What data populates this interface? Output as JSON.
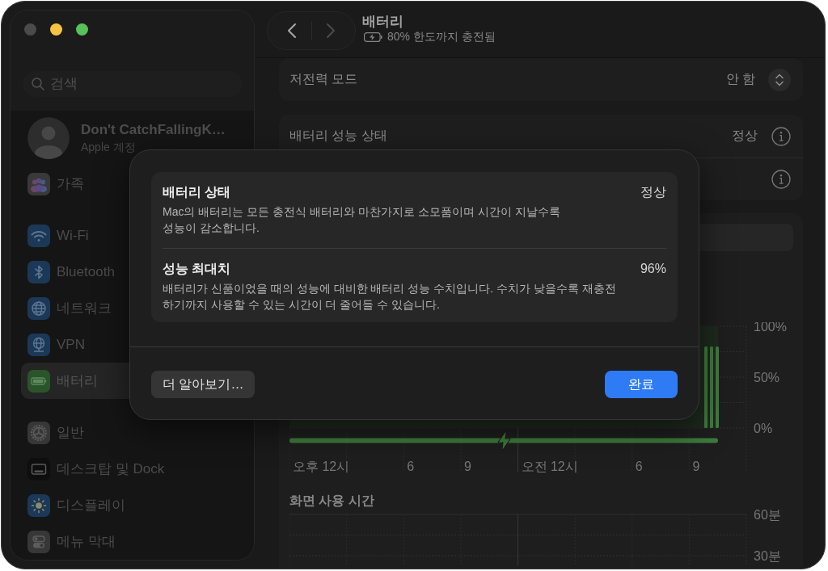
{
  "window": {
    "traffic_lights": [
      {
        "kind": "close",
        "disabled": true
      },
      {
        "kind": "minimize",
        "disabled": false
      },
      {
        "kind": "zoom",
        "disabled": false
      }
    ]
  },
  "sidebar": {
    "search": {
      "placeholder": "검색"
    },
    "account": {
      "name": "Don't CatchFallingK…",
      "subtitle": "Apple 계정"
    },
    "sections": [
      {
        "items": [
          {
            "label": "가족",
            "kind": "family",
            "selected": false
          }
        ]
      },
      {
        "items": [
          {
            "label": "Wi-Fi",
            "kind": "wifi",
            "selected": false
          },
          {
            "label": "Bluetooth",
            "kind": "bluetooth",
            "selected": false
          },
          {
            "label": "네트워크",
            "kind": "network",
            "selected": false
          },
          {
            "label": "VPN",
            "kind": "vpn",
            "selected": false
          },
          {
            "label": "배터리",
            "kind": "battery",
            "selected": true
          }
        ]
      },
      {
        "items": [
          {
            "label": "일반",
            "kind": "general",
            "selected": false
          },
          {
            "label": "데스크탑 및 Dock",
            "kind": "dock",
            "selected": false
          },
          {
            "label": "디스플레이",
            "kind": "display",
            "selected": false
          },
          {
            "label": "메뉴 막대",
            "kind": "menubar",
            "selected": false
          }
        ]
      }
    ]
  },
  "toolbar": {
    "nav_buttons": [
      {
        "kind": "back",
        "disabled": false
      },
      {
        "kind": "forward",
        "disabled": true
      }
    ],
    "title": "배터리",
    "subtitle": "80% 한도까지 충전됨"
  },
  "settings": {
    "cards": [
      {
        "rows": [
          {
            "kind": "popup",
            "label": "저전력 모드",
            "value": "안 함"
          }
        ]
      },
      {
        "rows": [
          {
            "kind": "info",
            "label": "배터리 성능 상태",
            "value": "정상"
          },
          {
            "kind": "info"
          }
        ]
      }
    ]
  },
  "battery_chart": {
    "charging": true,
    "y_labels": [
      "100%",
      "50%",
      "0%"
    ],
    "x_gridlines": [
      {
        "kind": "dotted",
        "label": "오후 12시"
      },
      {
        "kind": "dotted"
      },
      {
        "kind": "dotted",
        "label": "6"
      },
      {
        "kind": "dotted",
        "label": "9"
      },
      {
        "kind": "solid",
        "label": "오전 12시"
      },
      {
        "kind": "dotted"
      },
      {
        "kind": "dotted",
        "label": "6"
      },
      {
        "kind": "dotted",
        "label": "9"
      },
      {
        "kind": "dotted"
      }
    ]
  },
  "screen_time": {
    "title": "화면 사용 시간",
    "axis_labels": [
      "60분",
      "30분"
    ]
  },
  "dialog": {
    "rows": [
      {
        "title": "배터리 상태",
        "value": "정상",
        "description": "Mac의 배터리는 모든 충전식 배터리와 마찬가지로 소모품이며 시간이 지날수록\n성능이 감소합니다."
      },
      {
        "title": "성능 최대치",
        "value": "96%",
        "description": "배터리가 신품이었을 때의 성능에 대비한 배터리 성능 수치입니다. 수치가 낮을수록 재충전\n하기까지 사용할 수 있는 시간이 더 줄어들 수 있습니다."
      }
    ],
    "buttons": [
      {
        "kind": "secondary",
        "label": "더 알아보기…"
      },
      {
        "kind": "default",
        "label": "완료"
      }
    ]
  }
}
